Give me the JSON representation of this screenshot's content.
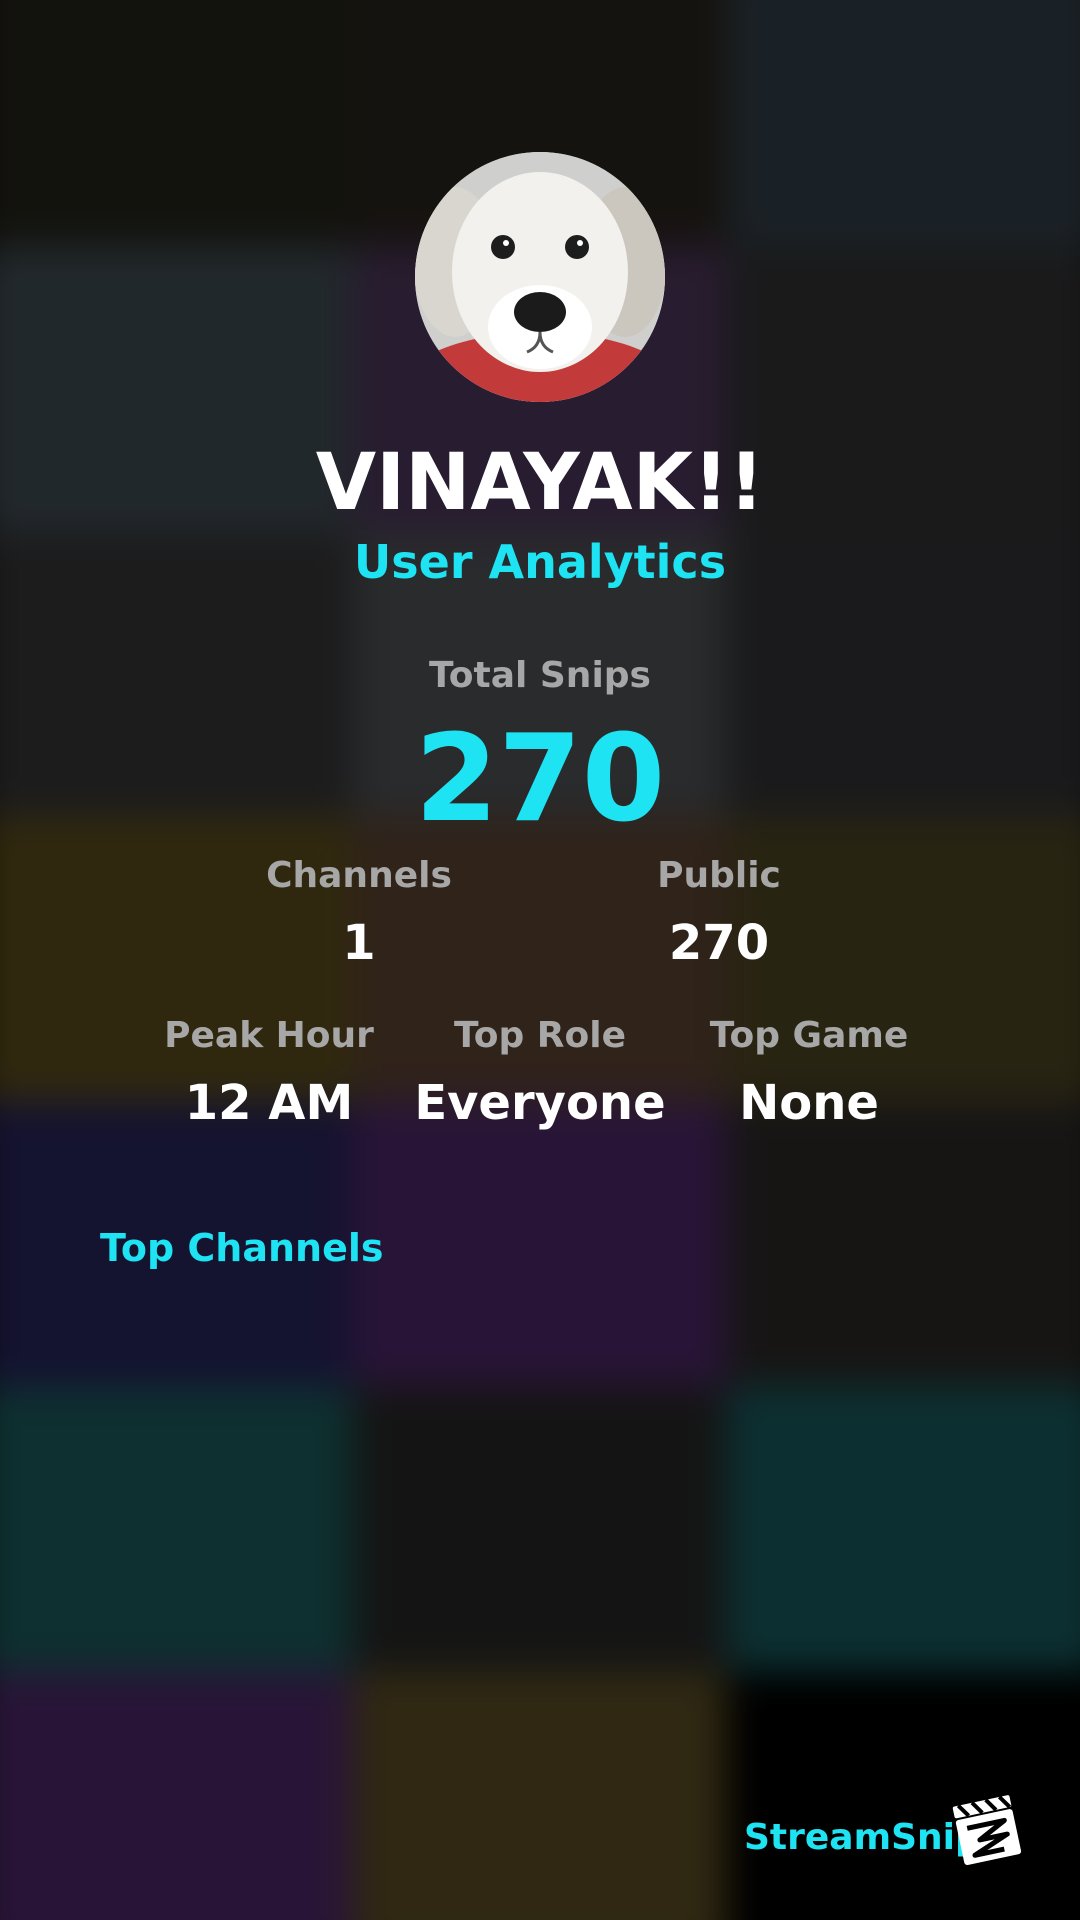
{
  "profile": {
    "username": "VINAYAK!!",
    "subtitle": "User Analytics",
    "avatar_icon": "dog-avatar-icon"
  },
  "totals": {
    "label": "Total Snips",
    "value": "270"
  },
  "stats_row1": [
    {
      "label": "Channels",
      "value": "1"
    },
    {
      "label": "Public",
      "value": "270"
    }
  ],
  "stats_row2": [
    {
      "label": "Peak Hour",
      "value": "12 AM"
    },
    {
      "label": "Top Role",
      "value": "Everyone"
    },
    {
      "label": "Top Game",
      "value": "None"
    }
  ],
  "sections": {
    "top_channels": "Top Channels"
  },
  "brand": {
    "name": "StreamSnip",
    "icon": "clapperboard-icon"
  },
  "colors": {
    "accent": "#1de3f2",
    "label": "#a7a7a7",
    "text": "#ffffff"
  }
}
